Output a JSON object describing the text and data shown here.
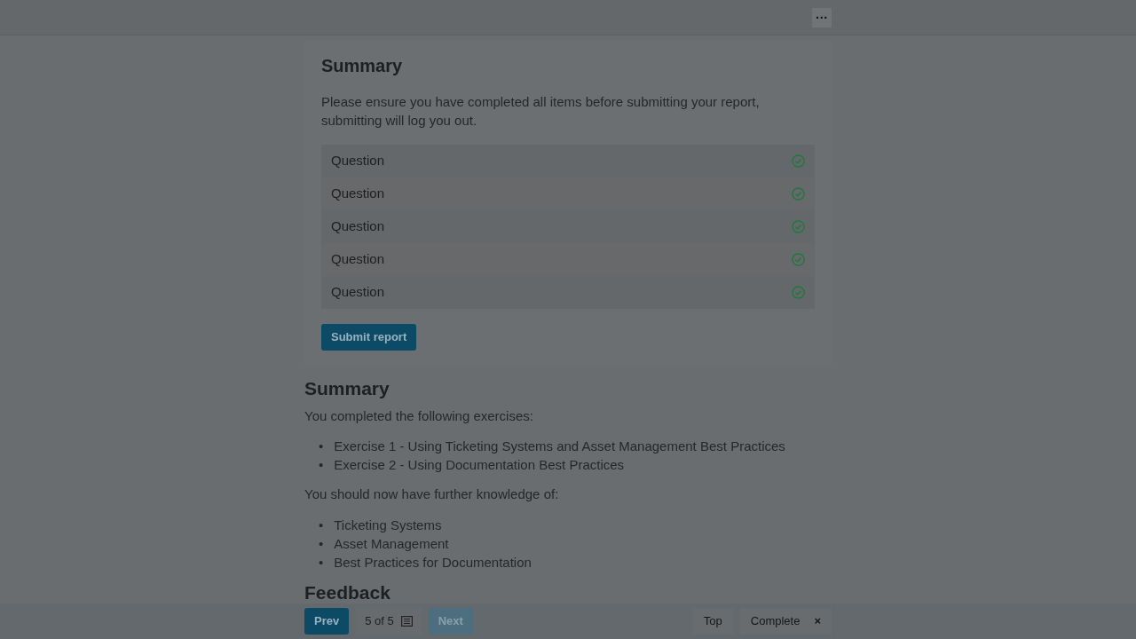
{
  "top_bar": {
    "menu_button": "···"
  },
  "summary_panel": {
    "title": "Summary",
    "message": "Please ensure you have completed all items before submitting your report, submitting will log you out.",
    "questions": [
      {
        "label": "Question",
        "completed": true
      },
      {
        "label": "Question",
        "completed": true
      },
      {
        "label": "Question",
        "completed": true
      },
      {
        "label": "Question",
        "completed": true
      },
      {
        "label": "Question",
        "completed": true
      }
    ],
    "submit_button": "Submit report"
  },
  "summary": {
    "title": "Summary",
    "list_marker": "•",
    "intro": "You completed the following exercises:",
    "exercises": [
      "Exercise 1 - Using Ticketing Systems and Asset Management Best Practices",
      "Exercise 2 - Using Documentation Best Practices"
    ],
    "knowledge_intro": "You should now have further knowledge of:",
    "knowledge": [
      "Ticketing Systems",
      "Asset Management",
      "Best Practices for Documentation"
    ]
  },
  "next_heading": "Feedback",
  "footer": {
    "prev": {
      "label": "Prev",
      "disabled": false
    },
    "page": "5 of 5",
    "next": {
      "label": "Next",
      "disabled": true
    },
    "top": "Top",
    "complete": "Complete",
    "close": "×"
  }
}
